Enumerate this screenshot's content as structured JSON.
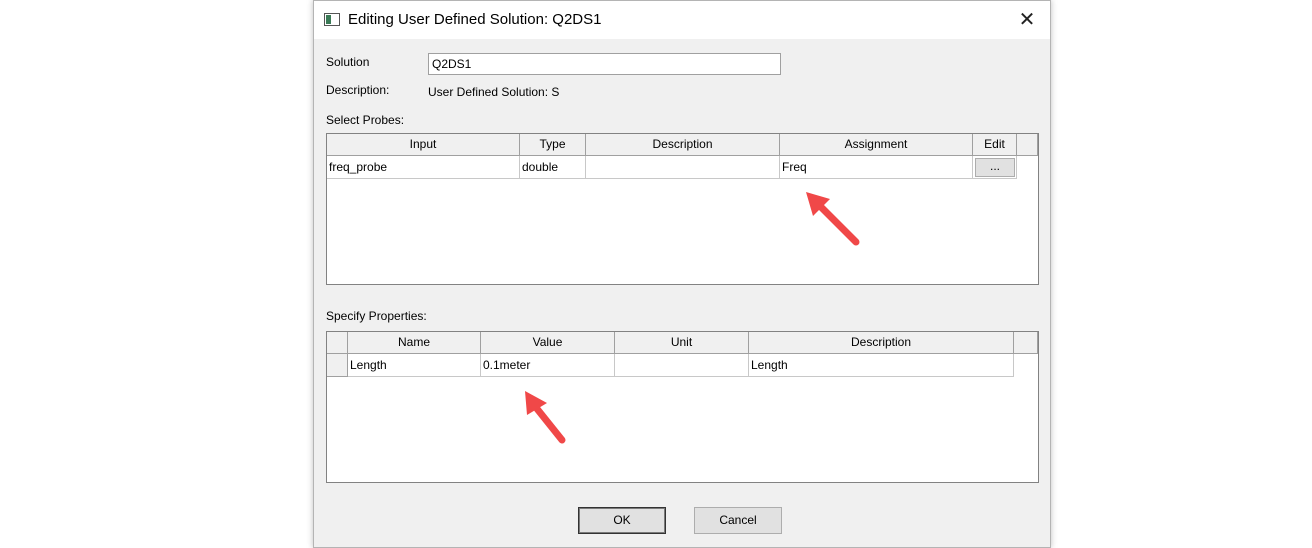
{
  "dialog": {
    "title": "Editing User Defined Solution: Q2DS1",
    "close_glyph": "✕"
  },
  "form": {
    "solution_label": "Solution",
    "solution_value": "Q2DS1",
    "description_label": "Description:",
    "description_value": "User Defined Solution: S"
  },
  "probes": {
    "section_label": "Select Probes:",
    "columns": [
      "Input",
      "Type",
      "Description",
      "Assignment",
      "Edit"
    ],
    "rows": [
      {
        "input": "freq_probe",
        "type": "double",
        "description": "",
        "assignment": "Freq",
        "edit": "..."
      }
    ]
  },
  "properties": {
    "section_label": "Specify Properties:",
    "columns": [
      "Name",
      "Value",
      "Unit",
      "Description"
    ],
    "rows": [
      {
        "name": "Length",
        "value": "0.1meter",
        "unit": "",
        "description": "Length"
      }
    ]
  },
  "buttons": {
    "ok": "OK",
    "cancel": "Cancel"
  },
  "annotations": {
    "arrow_color": "#f04848"
  }
}
